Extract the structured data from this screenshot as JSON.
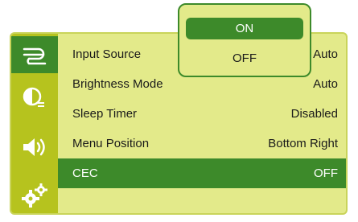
{
  "colors": {
    "accent": "#3d8a2a",
    "panel": "#e3ea8a",
    "sidebar": "#b6c31e",
    "text": "#1a1a1a",
    "selected_text": "#ffffff"
  },
  "sidebar": {
    "items": [
      {
        "icon": "input-cable-icon",
        "active": true
      },
      {
        "icon": "picture-contrast-icon",
        "active": false
      },
      {
        "icon": "speaker-volume-icon",
        "active": false
      },
      {
        "icon": "gears-settings-icon",
        "active": false
      }
    ]
  },
  "menu": {
    "rows": [
      {
        "label": "Input Source",
        "value": "Auto"
      },
      {
        "label": "Brightness Mode",
        "value": "Auto"
      },
      {
        "label": "Sleep Timer",
        "value": "Disabled"
      },
      {
        "label": "Menu Position",
        "value": "Bottom Right"
      },
      {
        "label": "CEC",
        "value": "OFF",
        "selected": true
      }
    ]
  },
  "popup": {
    "options": [
      {
        "label": "ON",
        "highlighted": true
      },
      {
        "label": "OFF",
        "highlighted": false
      }
    ]
  }
}
